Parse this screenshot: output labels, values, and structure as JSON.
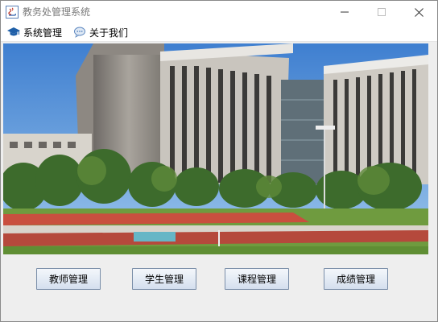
{
  "window": {
    "title": "教务处管理系统"
  },
  "menu": [
    {
      "label": "系统管理",
      "icon": "graduation-cap-icon"
    },
    {
      "label": "关于我们",
      "icon": "chat-icon"
    }
  ],
  "photo": {
    "subject": "campus-building-photo"
  },
  "buttons": [
    {
      "label": "教师管理"
    },
    {
      "label": "学生管理"
    },
    {
      "label": "课程管理"
    },
    {
      "label": "成绩管理"
    }
  ]
}
